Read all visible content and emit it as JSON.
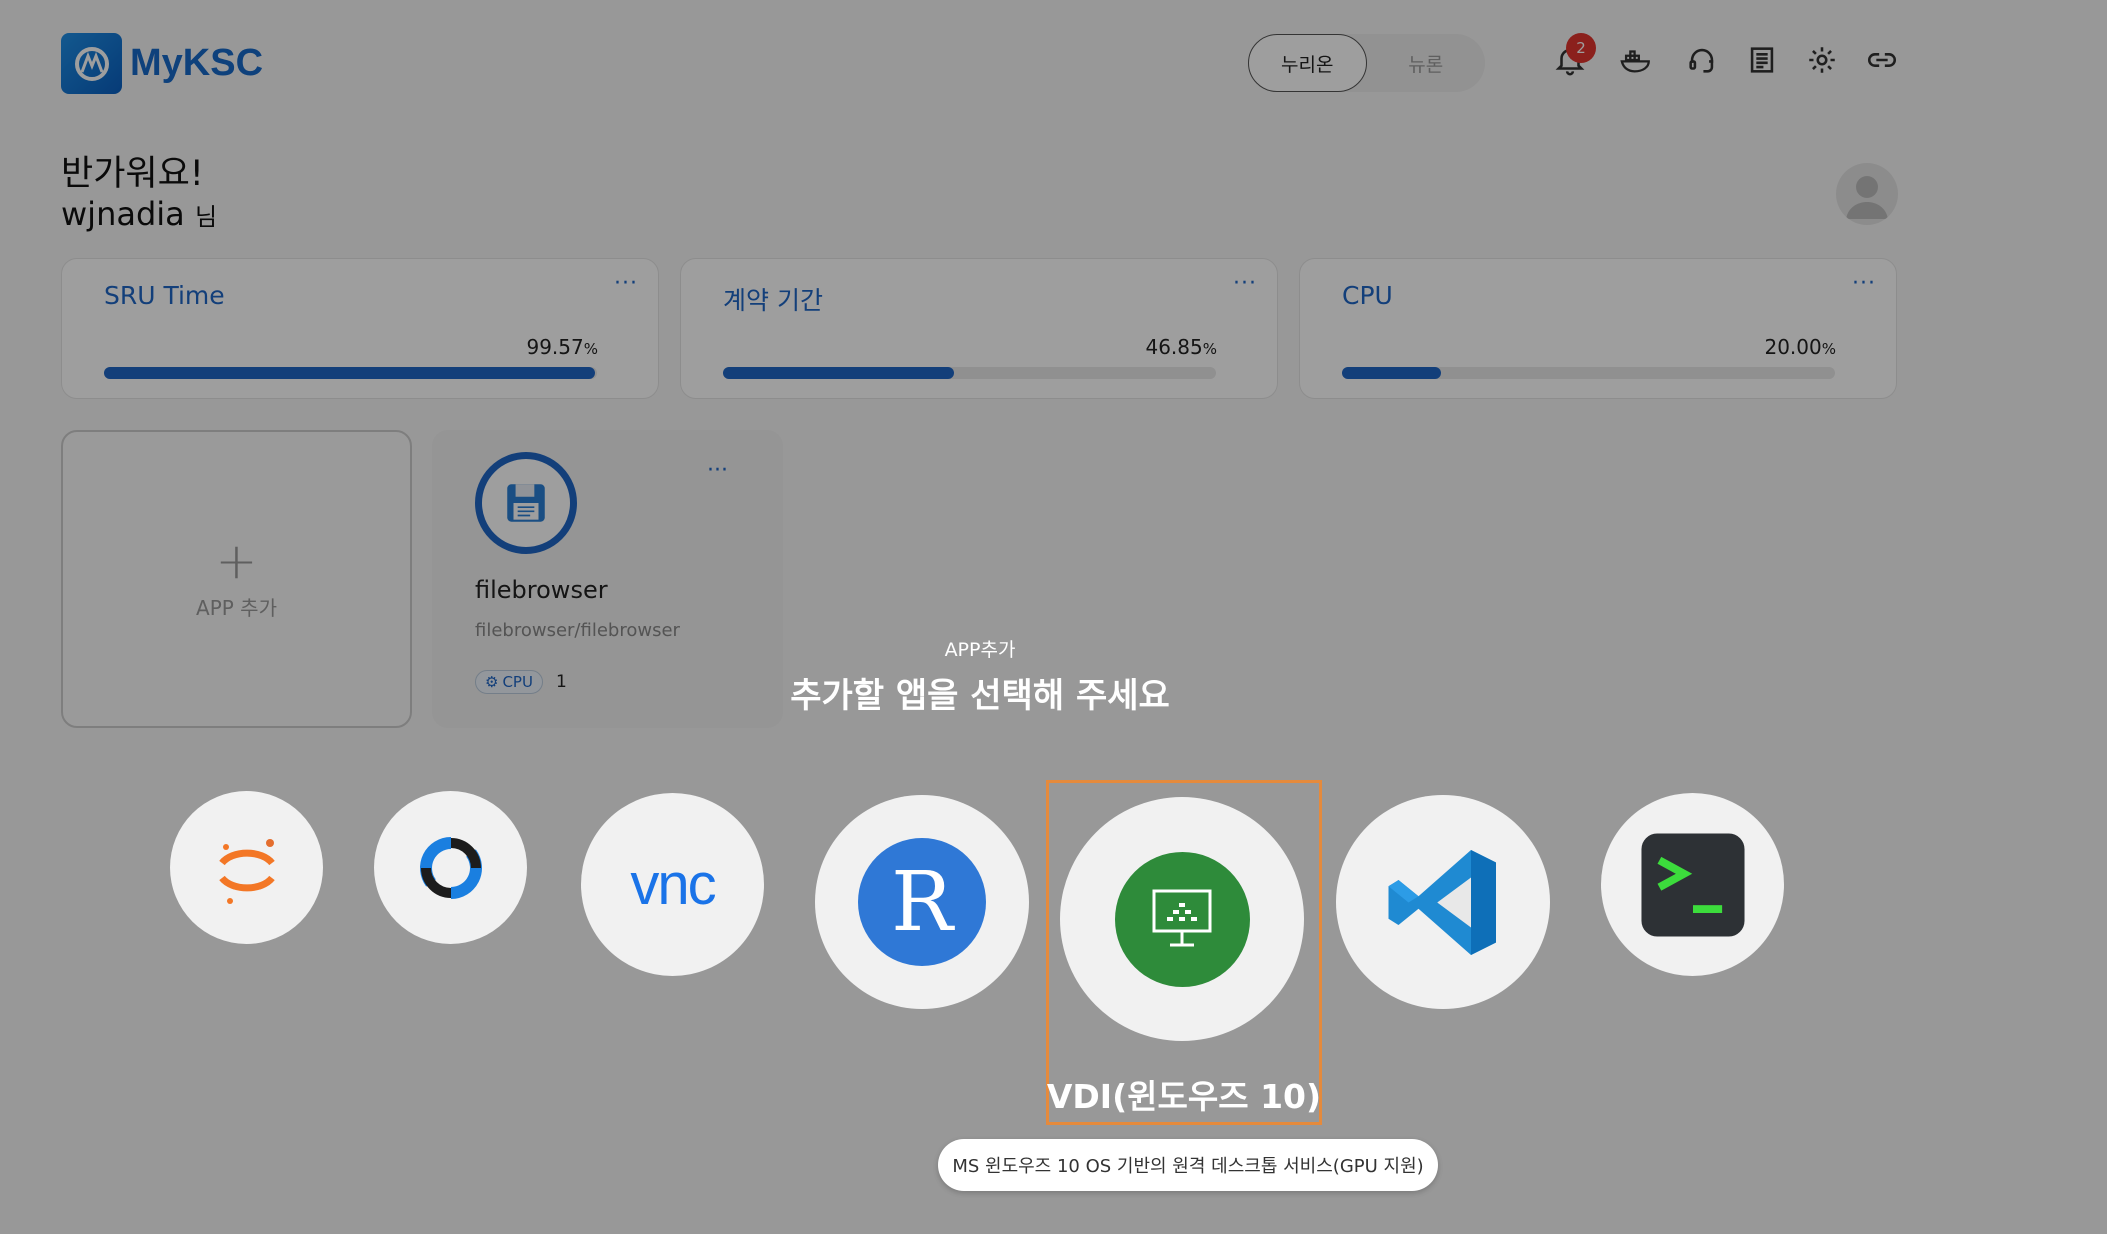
{
  "header": {
    "logo_text": "MyKSC",
    "toggle": {
      "active": "누리온",
      "inactive": "뉴론"
    },
    "notification_count": "2",
    "icons": [
      "bell-icon",
      "docker-icon",
      "headset-icon",
      "document-icon",
      "gear-icon",
      "link-icon"
    ]
  },
  "greeting": {
    "line1": "반가워요!",
    "username": "wjnadia",
    "suffix": "님"
  },
  "stats": [
    {
      "title": "SRU Time",
      "value": "99.57",
      "unit": "%",
      "percent": 99.57
    },
    {
      "title": "계약 기간",
      "value": "46.85",
      "unit": "%",
      "percent": 46.85
    },
    {
      "title": "CPU",
      "value": "20.00",
      "unit": "%",
      "percent": 20.0
    }
  ],
  "apps": {
    "add_label": "APP 추가",
    "filebrowser": {
      "name": "filebrowser",
      "path": "filebrowser/filebrowser",
      "chip": "CPU",
      "count": "1"
    }
  },
  "modal": {
    "subtitle": "APP추가",
    "title": "추가할 앱을 선택해 주세요",
    "options": [
      "jupyter",
      "rstudio-alt",
      "vnc",
      "R",
      "VDI(윈도우즈 10)",
      "vscode",
      "terminal"
    ],
    "vnc_text": "vnc",
    "r_text": "R",
    "selected_label": "VDI(윈도우즈 10)",
    "tooltip": "MS 윈도우즈 10 OS 기반의 원격 데스크톱 서비스(GPU 지원)"
  },
  "colors": {
    "accent": "#1f66c6",
    "badge": "#e0342e",
    "selection": "#e58a3c"
  }
}
